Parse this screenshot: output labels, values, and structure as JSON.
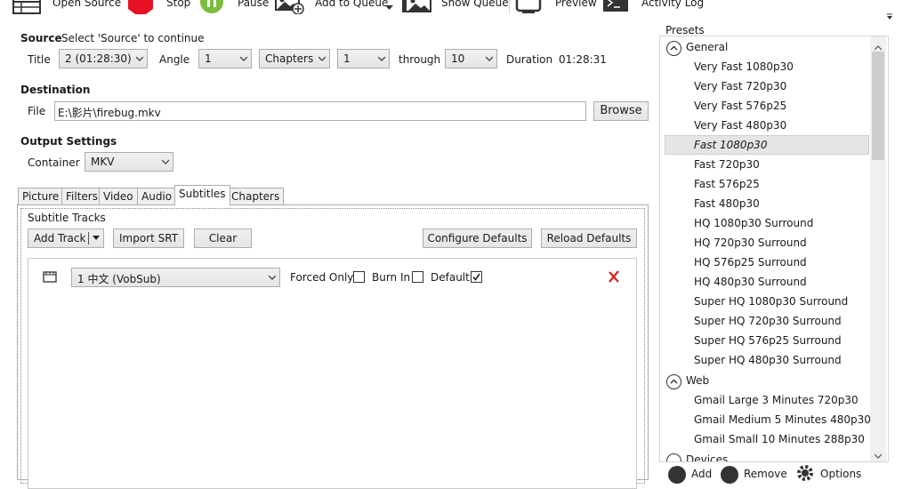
{
  "toolbar": {
    "open_source": "Open Source",
    "stop": "Stop",
    "pause": "Pause",
    "add_to_queue": "Add to Queue",
    "show_queue": "Show Queue",
    "preview": "Preview",
    "activity_log": "Activity Log"
  },
  "source": {
    "label": "Source",
    "hint": "Select 'Source' to continue",
    "title_label": "Title",
    "title_value": "2 (01:28:30)",
    "angle_label": "Angle",
    "angle_value": "1",
    "range_type": "Chapters",
    "range_start": "1",
    "through_label": "through",
    "range_end": "10",
    "duration_label": "Duration",
    "duration_value": "01:28:31"
  },
  "destination": {
    "label": "Destination",
    "file_label": "File",
    "file_value": "E:\\影片\\firebug.mkv",
    "browse": "Browse"
  },
  "output": {
    "label": "Output Settings",
    "container_label": "Container",
    "container_value": "MKV"
  },
  "tabs": [
    "Picture",
    "Filters",
    "Video",
    "Audio",
    "Subtitles",
    "Chapters"
  ],
  "subtitles": {
    "header": "Subtitle Tracks",
    "add_track": "Add Track",
    "import_srt": "Import SRT",
    "clear": "Clear",
    "configure_defaults": "Configure Defaults",
    "reload_defaults": "Reload Defaults",
    "track": {
      "value": "1 中文 (VobSub)",
      "forced_only": "Forced Only",
      "burn_in": "Burn In",
      "default": "Default",
      "forced_checked": false,
      "burn_checked": false,
      "default_checked": true
    }
  },
  "presets": {
    "label": "Presets",
    "groups": [
      {
        "name": "General",
        "items": [
          "Very Fast 1080p30",
          "Very Fast 720p30",
          "Very Fast 576p25",
          "Very Fast 480p30",
          "Fast 1080p30",
          "Fast 720p30",
          "Fast 576p25",
          "Fast 480p30",
          "HQ 1080p30 Surround",
          "HQ 720p30 Surround",
          "HQ 576p25 Surround",
          "HQ 480p30 Surround",
          "Super HQ 1080p30 Surround",
          "Super HQ 720p30 Surround",
          "Super HQ 576p25 Surround",
          "Super HQ 480p30 Surround"
        ]
      },
      {
        "name": "Web",
        "items": [
          "Gmail Large 3 Minutes 720p30",
          "Gmail Medium 5 Minutes 480p30",
          "Gmail Small 10 Minutes 288p30"
        ]
      },
      {
        "name": "Devices",
        "items": []
      }
    ],
    "selected": "Fast 1080p30",
    "add": "Add",
    "remove": "Remove",
    "options": "Options"
  },
  "colors": {
    "stop_red": "#e81123",
    "pause_green": "#7cbb3d",
    "remove_red": "#d42020"
  }
}
